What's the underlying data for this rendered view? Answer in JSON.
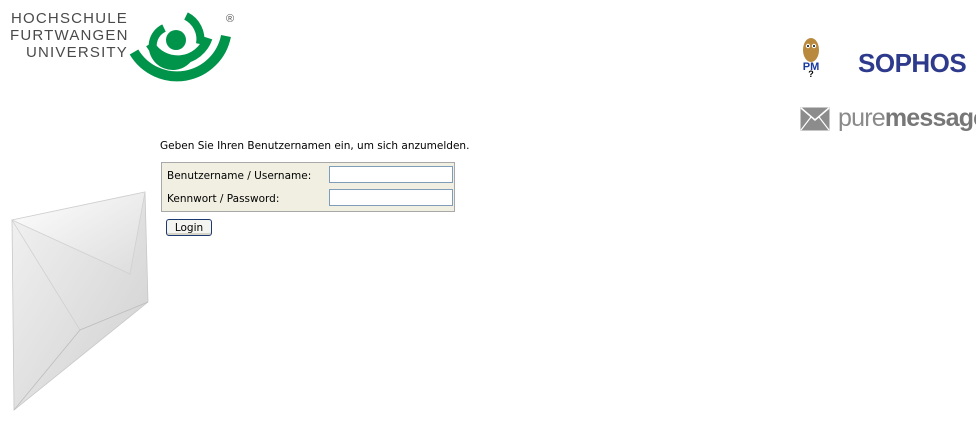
{
  "university_logo": {
    "lines": [
      "HOCHSCHULE",
      "FURTWANGEN",
      "UNIVERSITY"
    ],
    "registered_mark": "®",
    "brand_color": "#00934a"
  },
  "vendor_logos": {
    "pm_badge": "PM",
    "sophos": "SOPHOS",
    "puremessage_light": "pure",
    "puremessage_bold": "message",
    "sophos_color": "#2e3a8c"
  },
  "login": {
    "instructions": "Geben Sie Ihren Benutzernamen ein, um sich anzumelden.",
    "username_label": "Benutzername / Username:",
    "username_value": "",
    "password_label": "Kennwort / Password:",
    "password_value": "",
    "button_label": "Login"
  }
}
